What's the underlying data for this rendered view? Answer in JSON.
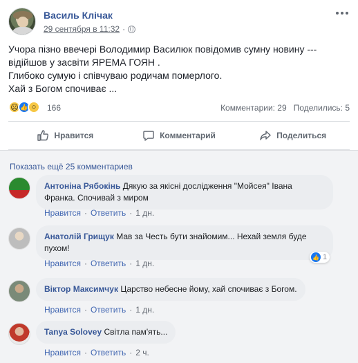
{
  "post": {
    "author": "Василь Клічак",
    "date": "29 сентября в 11:32",
    "separator": "·",
    "text_lines": [
      "Учора пізно ввечері Володимир Василюк повідомив сумну новину ---",
      "відійшов у засвіти ЯРЕМА ГОЯН .",
      "Глибоко сумую і співчуваю родичам померлого.",
      "Хай з Богом спочиває ..."
    ],
    "reaction_count": "166",
    "comments_count": "Комментарии: 29",
    "shares_count": "Поделились: 5",
    "actions": {
      "like": "Нравится",
      "comment": "Комментарий",
      "share": "Поделиться"
    }
  },
  "comments_section": {
    "show_more": "Показать ещё 25 комментариев",
    "comments": [
      {
        "author": "Антоніна Рябокінь",
        "text": "Дякую за якісні дослідження \"Мойсея\" Івана Франка. Спочивай з миром",
        "like": "Нравится",
        "reply": "Ответить",
        "sep": "·",
        "time": "1 дн."
      },
      {
        "author": "Анатолій Грищук",
        "text": "Мав за Честь бути знайомим... Нехай земля буде пухом!",
        "like": "Нравится",
        "reply": "Ответить",
        "sep": "·",
        "time": "1 дн.",
        "likes": "1"
      },
      {
        "author": "Віктор Максимчук",
        "text": "Царство небесне йому, хай спочиває з Богом.",
        "like": "Нравится",
        "reply": "Ответить",
        "sep": "·",
        "time": "1 дн."
      },
      {
        "author": "Tanya Solovey",
        "text": "Світла пам'ять...",
        "like": "Нравится",
        "reply": "Ответить",
        "sep": "·",
        "time": "2 ч."
      }
    ]
  },
  "colors": {
    "link": "#385898",
    "meta": "#616770",
    "like_blue": "#1877f2",
    "bubble": "#ebedf0",
    "comments_bg": "#f2f3f5"
  }
}
